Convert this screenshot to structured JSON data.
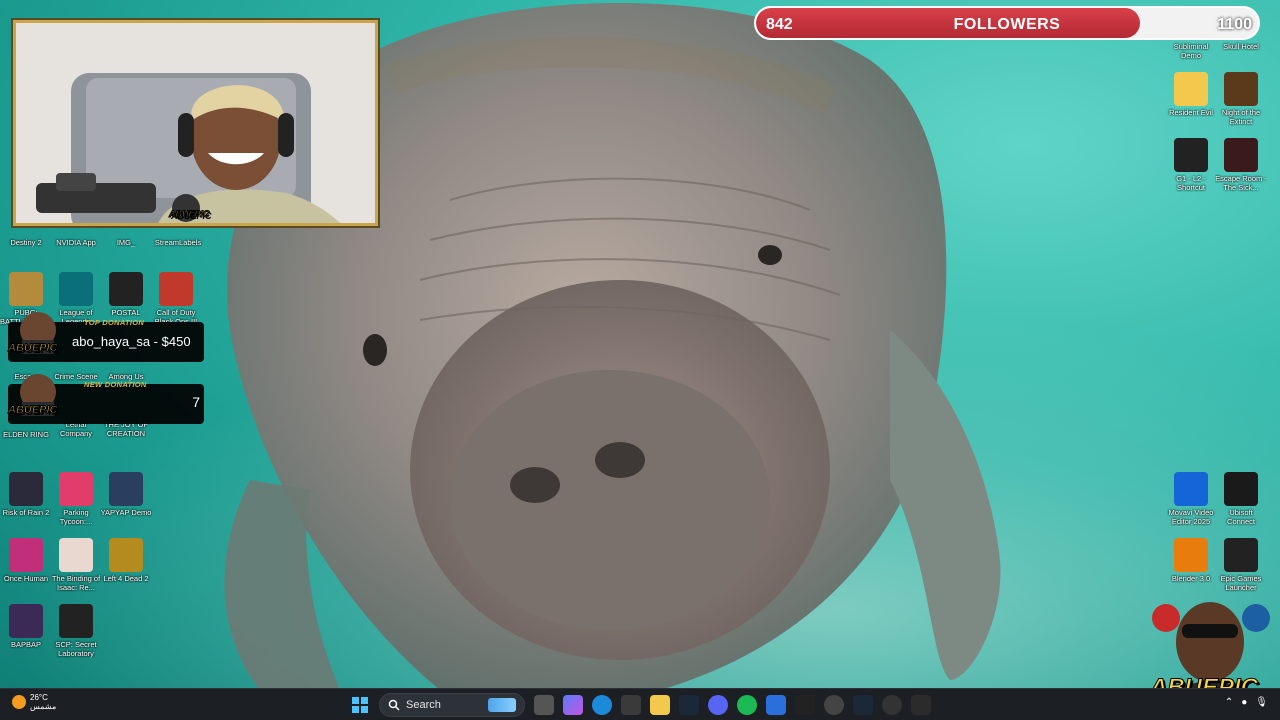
{
  "stream": {
    "followers": {
      "current": "842",
      "title": "FOLLOWERS",
      "goal": "1100",
      "progress": 0.765
    },
    "top_donation": {
      "title": "TOP DONATION",
      "text": "abo_haya_sa - $450"
    },
    "new_donation": {
      "title": "NEW DONATION",
      "value": "7"
    },
    "logo_text": "ABUEPIC",
    "logo_text_small": "ABUEPIC",
    "webcam_logo": "ABUEPIC"
  },
  "desktop": {
    "left_icons": [
      {
        "label": "Destiny 2",
        "icon": "destiny-icon",
        "color": "#3a3f4a"
      },
      {
        "label": "NVIDIA App",
        "icon": "nvidia-icon",
        "color": "#76b900"
      },
      {
        "label": "IMG_",
        "icon": "image-icon",
        "color": "#6a8fa8"
      },
      {
        "label": "StreamLabels",
        "icon": "streamlabels-icon",
        "color": "#444"
      },
      {
        "label": "PUBG: BATTLEGROUNDS",
        "icon": "pubg-icon",
        "color": "#b48a3c"
      },
      {
        "label": "League of Legends",
        "icon": "league-icon",
        "color": "#0b6f7a"
      },
      {
        "label": "POSTAL",
        "icon": "postal-icon",
        "color": "#222"
      },
      {
        "label": "Call of Duty Black Ops III",
        "icon": "cod-icon",
        "color": "#c0392b"
      },
      {
        "label": "Esca...",
        "icon": "escape-icon",
        "color": "#553322"
      },
      {
        "label": "Crime Scene",
        "icon": "crime-scene-icon",
        "color": "#555"
      },
      {
        "label": "Among Us",
        "icon": "among-us-icon",
        "color": "#c51111"
      },
      {
        "label": "ELDEN RING",
        "icon": "elden-ring-icon",
        "color": "#8a7a4a"
      },
      {
        "label": "Lethal Company",
        "icon": "lethal-company-icon",
        "color": "#7a1010"
      },
      {
        "label": "THE JOY OF CREATION",
        "icon": "joy-of-creation-icon",
        "color": "#333"
      },
      {
        "label": "Risk of Rain 2",
        "icon": "risk-of-rain-icon",
        "color": "#2a2a3a"
      },
      {
        "label": "Parking Tycoon:...",
        "icon": "parking-tycoon-icon",
        "color": "#e23c6a"
      },
      {
        "label": "YAPYAP Demo",
        "icon": "yapyap-icon",
        "color": "#2a3f5f"
      },
      {
        "label": "Once Human",
        "icon": "once-human-icon",
        "color": "#c12f7a"
      },
      {
        "label": "The Binding of Isaac: Re...",
        "icon": "isaac-icon",
        "color": "#e8d8d0"
      },
      {
        "label": "Left 4 Dead 2",
        "icon": "left4dead-icon",
        "color": "#b38b1e"
      },
      {
        "label": "BAPBAP",
        "icon": "bapbap-icon",
        "color": "#3a2a55"
      },
      {
        "label": "SCP: Secret Laboratory",
        "icon": "scp-icon",
        "color": "#222"
      }
    ],
    "right_icons": [
      {
        "label": "Subliminal Demo",
        "icon": "subliminal-icon",
        "color": "#888"
      },
      {
        "label": "Skull Hotel",
        "icon": "skull-hotel-icon",
        "color": "#222"
      },
      {
        "label": "Resident Evil",
        "icon": "folder-icon",
        "color": "#f2c94c"
      },
      {
        "label": "Night of the Extinct",
        "icon": "night-extinct-icon",
        "color": "#5a3a1a"
      },
      {
        "label": "G1 - L2 - Shortcut",
        "icon": "g1-shortcut-icon",
        "color": "#222"
      },
      {
        "label": "Escape Room - The Sick...",
        "icon": "escape-room-icon",
        "color": "#3a1a1a"
      },
      {
        "label": "Movavi Video Editor 2025",
        "icon": "movavi-icon",
        "color": "#1565d8"
      },
      {
        "label": "Ubisoft Connect",
        "icon": "ubisoft-icon",
        "color": "#1a1a1a"
      },
      {
        "label": "Blender 3.0",
        "icon": "blender-icon",
        "color": "#e87d0d"
      },
      {
        "label": "Epic Games Launcher",
        "icon": "epic-games-icon",
        "color": "#222"
      }
    ]
  },
  "taskbar": {
    "weather_temp": "26°C",
    "weather_desc": "مشمس",
    "search_placeholder": "Search",
    "start_icon": "windows-start-icon"
  }
}
